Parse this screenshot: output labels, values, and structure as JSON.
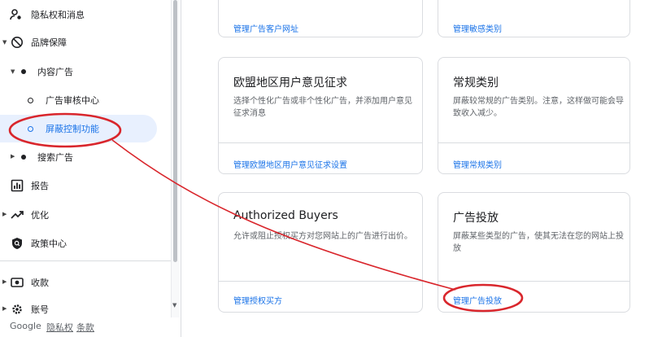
{
  "sidebar": {
    "items": [
      {
        "label": "隐私权和消息"
      },
      {
        "label": "品牌保障"
      },
      {
        "label": "内容广告"
      },
      {
        "label": "广告审核中心"
      },
      {
        "label": "屏蔽控制功能"
      },
      {
        "label": "搜索广告"
      },
      {
        "label": "报告"
      },
      {
        "label": "优化"
      },
      {
        "label": "政策中心"
      },
      {
        "label": "收款"
      },
      {
        "label": "账号"
      }
    ]
  },
  "footer": {
    "google": "Google",
    "privacy": "隐私权",
    "terms": "条款"
  },
  "cards": [
    {
      "link": "管理广告客户网址"
    },
    {
      "link": "管理敏感类别"
    },
    {
      "title": "欧盟地区用户意见征求",
      "desc": "选择个性化广告或非个性化广告，并添加用户意见征求消息",
      "link": "管理欧盟地区用户意见征求设置"
    },
    {
      "title": "常规类别",
      "desc": "屏蔽较常规的广告类别。注意，这样做可能会导致收入减少。",
      "link": "管理常规类别"
    },
    {
      "title": "Authorized Buyers",
      "desc": "允许或阻止授权买方对您网站上的广告进行出价。",
      "link": "管理授权买方"
    },
    {
      "title": "广告投放",
      "desc": "屏蔽某些类型的广告，使其无法在您的网站上投放",
      "link": "管理广告投放"
    }
  ],
  "colors": {
    "accent": "#1a73e8",
    "annotation": "#d9262c"
  }
}
